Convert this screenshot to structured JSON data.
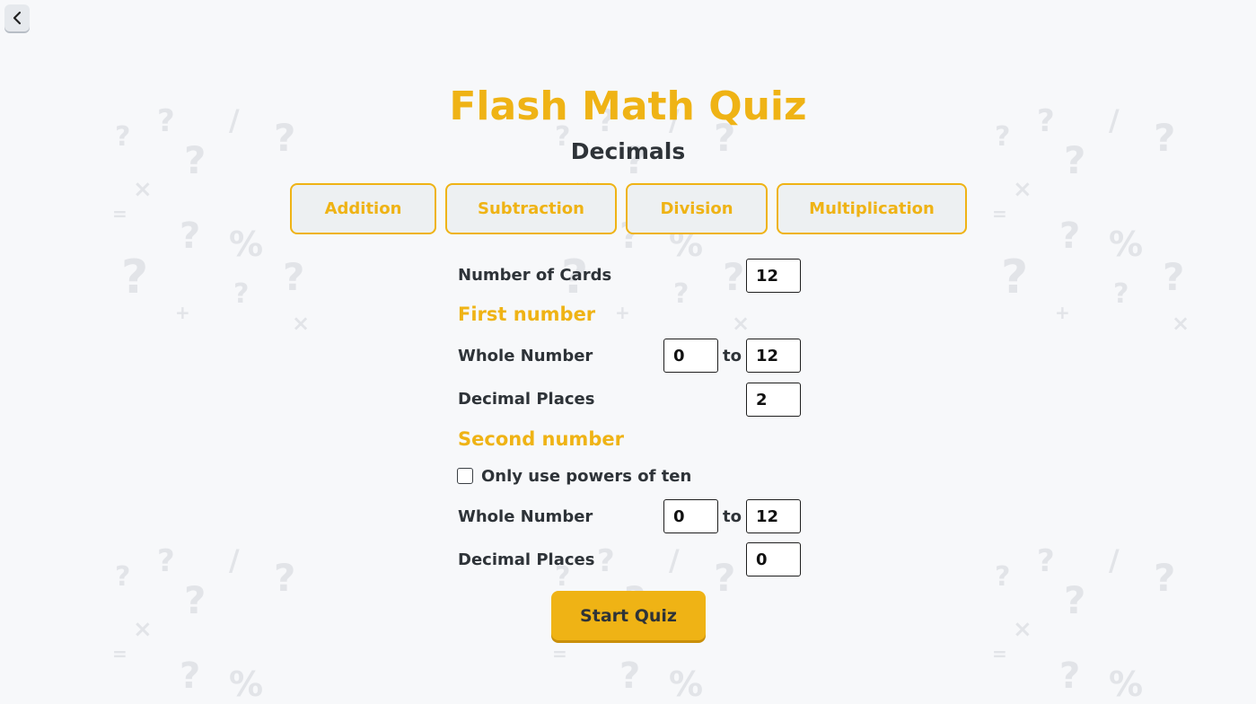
{
  "header": {
    "back_icon": "chevron-left-icon"
  },
  "title": "Flash Math Quiz",
  "subtitle": "Decimals",
  "operations": [
    {
      "label": "Addition"
    },
    {
      "label": "Subtraction"
    },
    {
      "label": "Division"
    },
    {
      "label": "Multiplication"
    }
  ],
  "settings": {
    "number_of_cards_label": "Number of Cards",
    "number_of_cards_value": "12",
    "first_number": {
      "heading": "First number",
      "whole_number_label": "Whole Number",
      "whole_from": "0",
      "to_label": "to",
      "whole_to": "12",
      "decimal_places_label": "Decimal Places",
      "decimal_places_value": "2"
    },
    "second_number": {
      "heading": "Second number",
      "powers_of_ten_label": "Only use powers of ten",
      "powers_of_ten_checked": false,
      "whole_number_label": "Whole Number",
      "whole_from": "0",
      "to_label": "to",
      "whole_to": "12",
      "decimal_places_label": "Decimal Places",
      "decimal_places_value": "0"
    }
  },
  "start_button_label": "Start Quiz",
  "colors": {
    "accent": "#efb315",
    "background": "#f7f8fa",
    "text": "#2e3338",
    "tab_fill": "#edf0f2"
  }
}
